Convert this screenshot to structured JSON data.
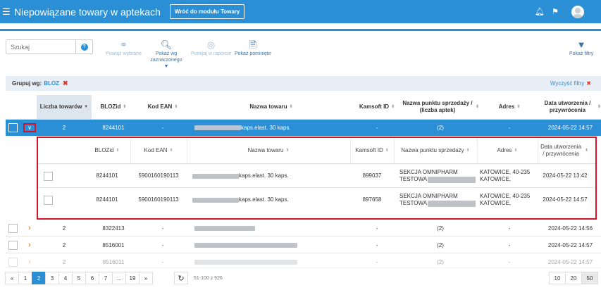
{
  "header": {
    "menu_icon": "hamburger-icon",
    "title": "Niepowiązane towary w aptekach",
    "back_button": "Wróć do modułu Towary",
    "icons": [
      "bell-icon",
      "flag-icon",
      "user-avatar"
    ],
    "color": "#2b8fd6"
  },
  "toolbar": {
    "search_placeholder": "Szukaj",
    "help_icon": "question-icon",
    "actions": [
      {
        "label": "Powiąż wybrane",
        "icon": "link-icon",
        "enabled": false
      },
      {
        "label": "Pokaż wg zaznaczonego",
        "icon": "search-icon",
        "enabled": true,
        "dropdown": true
      },
      {
        "label": "Pomijaj w raporcie",
        "icon": "eye-off-icon",
        "enabled": false
      },
      {
        "label": "Pokaż pominięte",
        "icon": "document-icon",
        "enabled": true
      }
    ],
    "filter_button": "Pokaż filtry"
  },
  "group_bar": {
    "label": "Grupuj wg:",
    "value": "BLOZ",
    "clear_filters": "Wyczyść filtry"
  },
  "table": {
    "columns": [
      "Liczba towarów",
      "BLOZid",
      "Kod EAN",
      "Nazwa towaru",
      "Kamsoft ID",
      "Nazwa punktu sprzedaży / (liczba aptek)",
      "Adres",
      "Data utworzenia / przywrócenia"
    ],
    "rows": [
      {
        "count": "2",
        "bloz": "8244101",
        "ean": "-",
        "name": "kaps.elast. 30 kaps.",
        "kamsoft": "-",
        "point": "(2)",
        "address": "-",
        "date": "2024-05-22 14:57",
        "selected": true,
        "expanded": true
      },
      {
        "count": "2",
        "bloz": "8322413",
        "ean": "-",
        "name": "",
        "kamsoft": "-",
        "point": "(2)",
        "address": "-",
        "date": "2024-05-22 14:56"
      },
      {
        "count": "2",
        "bloz": "8516001",
        "ean": "-",
        "name": "",
        "kamsoft": "-",
        "point": "(2)",
        "address": "-",
        "date": "2024-05-22 14:57"
      },
      {
        "count": "2",
        "bloz": "8516011",
        "ean": "-",
        "name": "",
        "kamsoft": "-",
        "point": "(2)",
        "address": "-",
        "date": "2024-05-22 14:57"
      }
    ]
  },
  "subtable": {
    "columns": [
      "BLOZid",
      "Kod EAN",
      "Nazwa towaru",
      "Kamsoft ID",
      "Nazwa punktu sprzedaży",
      "Adres",
      "Data utworzenia / przywrócenia"
    ],
    "rows": [
      {
        "bloz": "8244101",
        "ean": "5900160190113",
        "name": "kaps.elast. 30 kaps.",
        "kamsoft": "899037",
        "point_line1": "SEKCJA OMNIPHARM",
        "point_line2": "TESTOWA",
        "address_line1": "KATOWICE, 40-235",
        "address_line2": "KATOWICE,",
        "date": "2024-05-22 13:42"
      },
      {
        "bloz": "8244101",
        "ean": "5900160190113",
        "name": "kaps.elast. 30 kaps.",
        "kamsoft": "897658",
        "point_line1": "SEKCJA OMNIPHARM",
        "point_line2": "TESTOWA",
        "address_line1": "KATOWICE, 40-235",
        "address_line2": "KATOWICE,",
        "date": "2024-05-22 14:57"
      }
    ]
  },
  "pagination": {
    "pages": [
      "«",
      "1",
      "2",
      "3",
      "4",
      "5",
      "6",
      "7",
      "...",
      "19",
      "»"
    ],
    "active_page": "2",
    "range_text": "51-100 z 926",
    "page_sizes": [
      "10",
      "20",
      "50"
    ],
    "active_size": "50"
  }
}
